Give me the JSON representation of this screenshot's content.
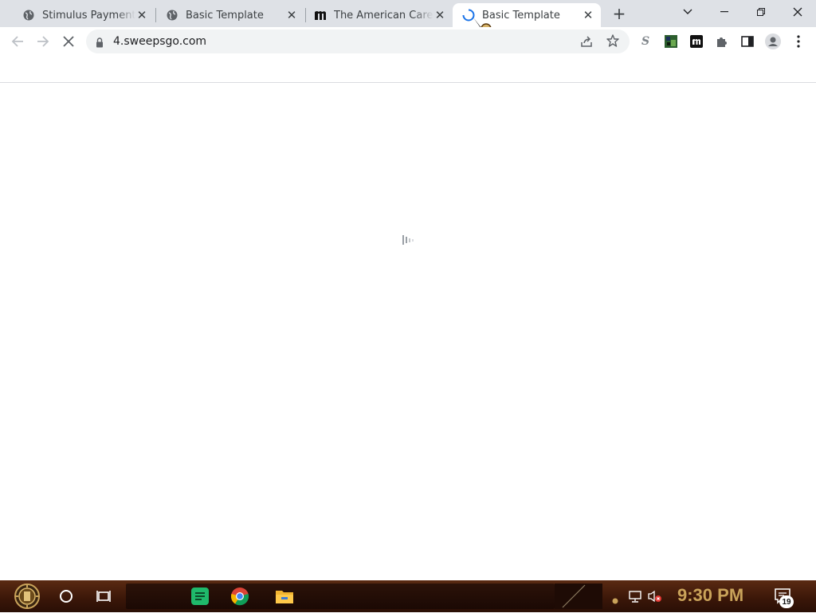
{
  "browser": {
    "tabs": [
      {
        "title": "Stimulus Payments & ",
        "icon": "globe-icon",
        "active": false
      },
      {
        "title": "Basic Template",
        "icon": "globe-icon",
        "active": false
      },
      {
        "title": "The American Career",
        "icon": "m-logo-icon",
        "active": false
      },
      {
        "title": "Basic Template",
        "icon": "loading-spinner-icon",
        "active": true
      }
    ],
    "new_tab_label": "+",
    "tab_search_icon": "chevron-down-icon",
    "window_controls": [
      "minimize-icon",
      "restore-icon",
      "close-icon"
    ],
    "toolbar": {
      "url": "4.sweepsgo.com",
      "buttons": [
        "back-icon",
        "forward-icon",
        "stop-loading-icon"
      ],
      "right_icons": [
        "share-icon",
        "bookmark-star-icon",
        "extension-s-icon",
        "extension-image-icon",
        "extension-m-icon",
        "extensions-puzzle-icon",
        "side-panel-icon",
        "profile-icon",
        "menu-dots-icon"
      ]
    }
  },
  "taskbar": {
    "time": "9:30 PM",
    "notification_count": "19",
    "icons": [
      "start-icon",
      "search-circle-icon",
      "task-view-icon",
      "notes-app-icon",
      "chrome-icon",
      "file-explorer-icon"
    ],
    "tray_icons": [
      "chevron-up-icon",
      "network-icon",
      "volume-muted-icon"
    ]
  },
  "colors": {
    "tabstrip": "#dee1e6",
    "taskbar": "#3a1608",
    "clock": "#c9a35a",
    "notes_green": "#1fb96b"
  }
}
